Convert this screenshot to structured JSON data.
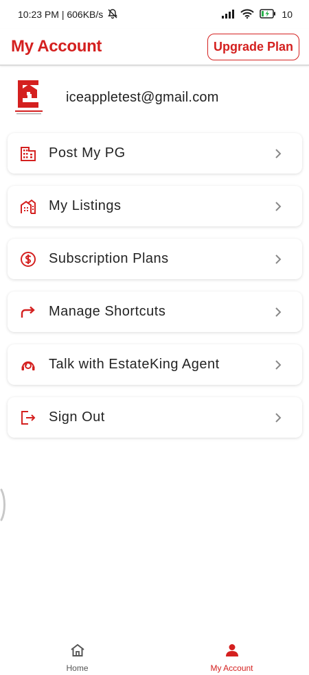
{
  "status_bar": {
    "time_speed": "10:23 PM | 606KB/s",
    "battery": "10"
  },
  "header": {
    "title": "My Account",
    "upgrade_label": "Upgrade Plan"
  },
  "profile": {
    "email": "iceappletest@gmail.com"
  },
  "menu": {
    "items": [
      {
        "label": "Post My PG",
        "icon": "building-icon"
      },
      {
        "label": "My Listings",
        "icon": "listings-icon"
      },
      {
        "label": "Subscription Plans",
        "icon": "dollar-circle-icon"
      },
      {
        "label": "Manage Shortcuts",
        "icon": "share-arrow-icon"
      },
      {
        "label": "Talk with EstateKing Agent",
        "icon": "agent-headset-icon"
      },
      {
        "label": "Sign Out",
        "icon": "sign-out-icon"
      }
    ]
  },
  "bottom_nav": {
    "home_label": "Home",
    "account_label": "My Account"
  },
  "colors": {
    "accent": "#d4201f",
    "text": "#232323",
    "muted": "#555555"
  }
}
